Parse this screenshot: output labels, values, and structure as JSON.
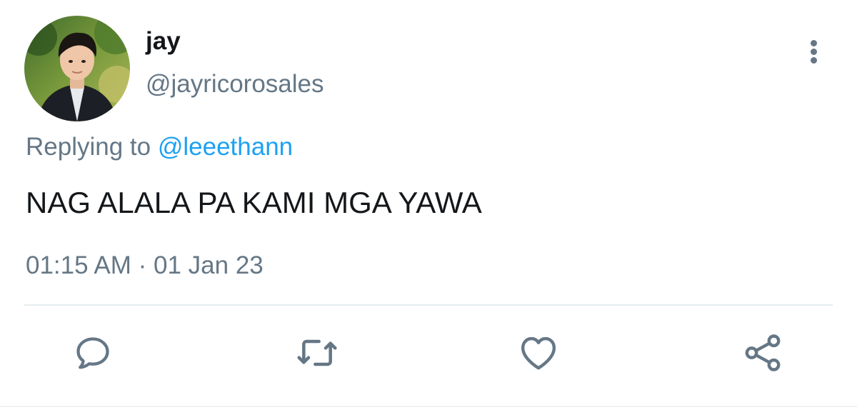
{
  "tweet": {
    "display_name": "jay",
    "handle": "@jayricorosales",
    "replying_prefix": "Replying to",
    "replying_to": "@leeethann",
    "text": "NAG ALALA PA KAMI MGA YAWA",
    "time": "01:15 AM",
    "separator": "·",
    "date": "01 Jan 23"
  },
  "icons": {
    "more": "more-vertical-icon",
    "reply": "reply-icon",
    "retweet": "retweet-icon",
    "like": "heart-icon",
    "share": "share-icon"
  },
  "colors": {
    "text_primary": "#14171a",
    "text_secondary": "#657786",
    "link": "#1da1f2",
    "divider": "#e6ecf0"
  }
}
